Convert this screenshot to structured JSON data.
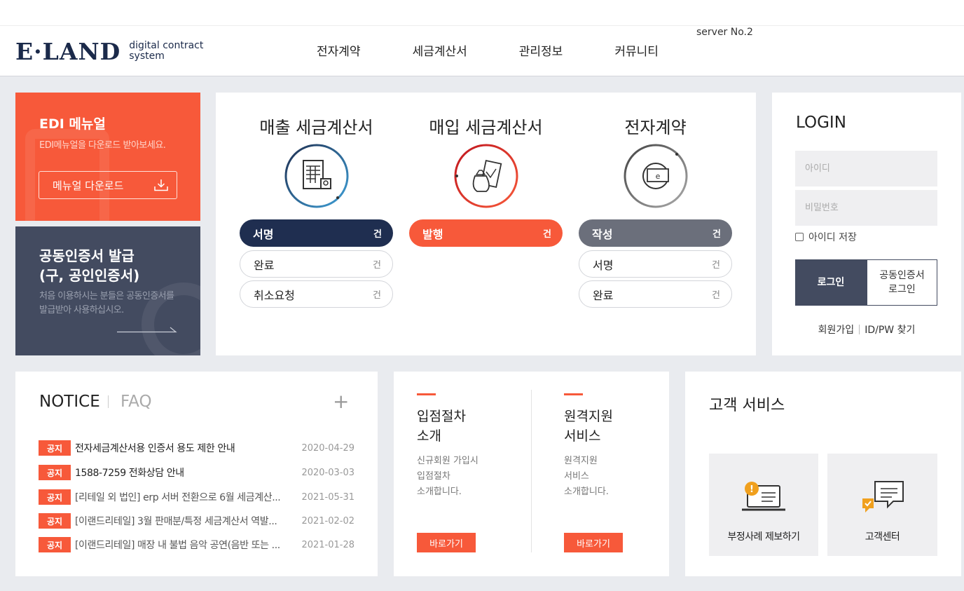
{
  "header": {
    "logo_main": "E·LAND",
    "logo_sub_line1": "digital contract",
    "logo_sub_line2": "system",
    "server": "server No.2",
    "nav": [
      "전자계약",
      "세금계산서",
      "관리정보",
      "커뮤니티"
    ]
  },
  "edi": {
    "title": "EDI 메뉴얼",
    "desc": "EDI메뉴얼을 다운로드 받아보세요.",
    "button": "메뉴얼 다운로드"
  },
  "cert": {
    "title_line1": "공동인증서 발급",
    "title_line2": "(구, 공인인증서)",
    "desc": "처음 이용하시는 분들은 공동인증서를 발급받아 사용하십시오."
  },
  "status": {
    "columns": [
      {
        "title": "매출 세금계산서",
        "items": [
          {
            "label": "서명",
            "count": "건"
          },
          {
            "label": "완료",
            "count": "건"
          },
          {
            "label": "취소요청",
            "count": "건"
          }
        ]
      },
      {
        "title": "매입 세금계산서",
        "items": [
          {
            "label": "발행",
            "count": "건"
          }
        ]
      },
      {
        "title": "전자계약",
        "items": [
          {
            "label": "작성",
            "count": "건"
          },
          {
            "label": "서명",
            "count": "건"
          },
          {
            "label": "완료",
            "count": "건"
          }
        ]
      }
    ]
  },
  "login": {
    "title": "LOGIN",
    "id_placeholder": "아이디",
    "pw_placeholder": "비밀번호",
    "save_id": "아이디 저장",
    "login_button": "로그인",
    "cert_login_line1": "공동인증서",
    "cert_login_line2": "로그인",
    "signup": "회원가입",
    "find": "ID/PW 찾기"
  },
  "notice": {
    "tab_notice": "NOTICE",
    "tab_faq": "FAQ",
    "more": "+",
    "rows": [
      {
        "badge": "공지",
        "title": "전자세금계산서용 인증서 용도 제한 안내",
        "date": "2020-04-29"
      },
      {
        "badge": "공지",
        "title": "1588-7259 전화상담 안내",
        "date": "2020-03-03"
      },
      {
        "badge": "공지",
        "title": "[리테일 외 법인] erp 서버 전환으로 6월 세금계산...",
        "date": "2021-05-31"
      },
      {
        "badge": "공지",
        "title": "[이랜드리테일] 3월 판매분/특정 세금계산서 역발...",
        "date": "2021-02-02"
      },
      {
        "badge": "공지",
        "title": "[이랜드리테일] 매장 내 불법 음악 공연(음반 또는 ...",
        "date": "2021-01-28"
      }
    ]
  },
  "intro": {
    "left": {
      "title_line1": "입점절차",
      "title_line2": "소개",
      "desc": [
        "신규회원 가입시",
        "입점절차",
        "소개합니다."
      ],
      "button": "바로가기"
    },
    "right": {
      "title_line1": "원격지원",
      "title_line2": "서비스",
      "desc": [
        "원격지원",
        "서비스",
        "소개합니다."
      ],
      "button": "바로가기"
    }
  },
  "customer": {
    "title": "고객 서비스",
    "report": "부정사례 제보하기",
    "center": "고객센터"
  },
  "colors": {
    "accent": "#f7593a",
    "navy": "#1f2e50",
    "slate": "#434b60"
  }
}
